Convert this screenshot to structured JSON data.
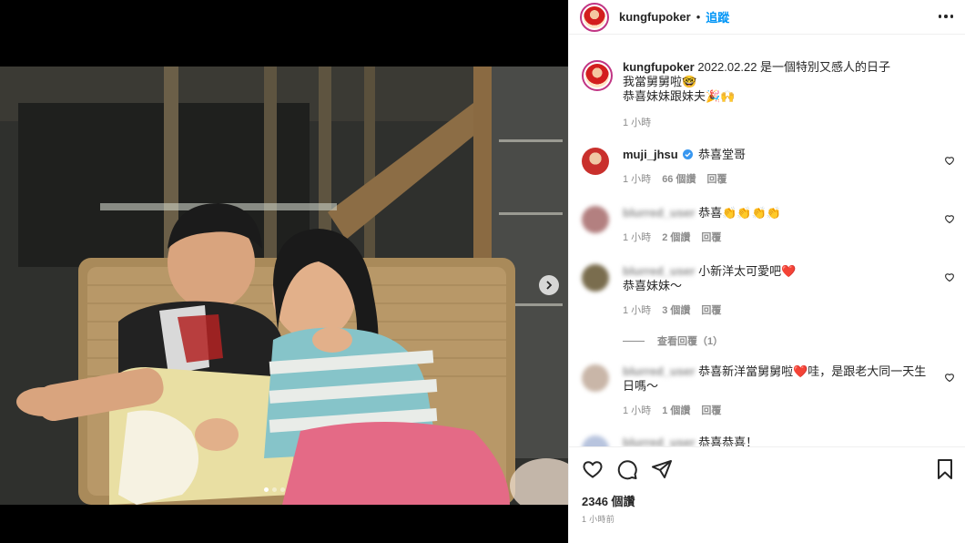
{
  "post": {
    "username": "kungfupoker",
    "separator": "•",
    "follow_label": "追蹤",
    "caption_user": "kungfupoker",
    "caption_line1": "2022.02.22 是一個特別又感人的日子",
    "caption_line2": "我當舅舅啦🤓",
    "caption_line3": "恭喜妹妹跟妹夫🎉🙌",
    "caption_time": "1 小時",
    "likes": "2346 個讚",
    "posted_ago": "1 小時前",
    "carousel": {
      "total": 3,
      "active_index": 1
    }
  },
  "comments": [
    {
      "user": "muji_jhsu",
      "verified": true,
      "text": "恭喜堂哥",
      "text2": "",
      "time": "1 小時",
      "likes": "66 個讚",
      "reply": "回覆",
      "avatar_color": "#c9302c"
    },
    {
      "user": "blurred_user",
      "text": "恭喜👏👏👏👏",
      "text2": "",
      "time": "1 小時",
      "likes": "2 個讚",
      "reply": "回覆",
      "avatar_color": "#b38080"
    },
    {
      "user": "blurred_user",
      "text": "小新洋太可愛吧❤️",
      "text2": "恭喜妹妹～",
      "time": "1 小時",
      "likes": "3 個讚",
      "reply": "回覆",
      "avatar_color": "#7a6d4e",
      "view_replies": "查看回覆（1）"
    },
    {
      "user": "blurred_user",
      "text": "恭喜新洋當舅舅啦❤️哇，是跟老大同一天生",
      "text2": "日嗎～",
      "time": "1 小時",
      "likes": "1 個讚",
      "reply": "回覆",
      "avatar_color": "#c9b6a8"
    },
    {
      "user": "blurred_user",
      "text": "恭喜恭喜！",
      "text2": "",
      "avatar_color": "#b8c4de"
    }
  ],
  "icons": {
    "like": "heart-icon",
    "comment": "comment-icon",
    "share": "paper-plane-icon",
    "save": "bookmark-icon",
    "more": "more-options-icon",
    "next": "chevron-right-icon",
    "verified": "verified-badge-icon"
  },
  "colors": {
    "accent": "#0095f6",
    "verified": "#3897f0",
    "text": "#262626",
    "muted": "#8e8e8e"
  }
}
